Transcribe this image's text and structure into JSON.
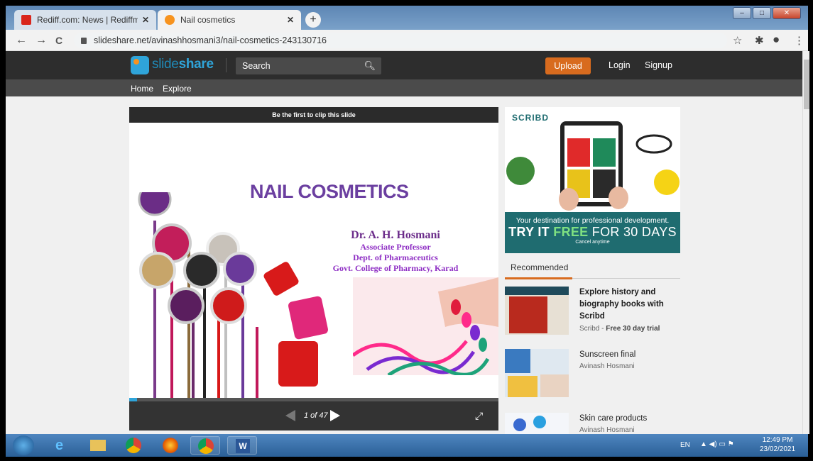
{
  "browser": {
    "tabs": [
      {
        "label": "Rediff.com: News | Rediffmail | St",
        "close": "✕"
      },
      {
        "label": "Nail cosmetics",
        "close": "✕"
      }
    ],
    "new_tab": "+",
    "url": "slideshare.net/avinashhosmani3/nail-cosmetics-243130716",
    "nav": {
      "back": "←",
      "forward": "→",
      "reload": "C"
    },
    "window_buttons": {
      "min": "–",
      "max": "□",
      "close": "✕"
    }
  },
  "slideshare": {
    "logo": "slideshare",
    "search_placeholder": "Search",
    "upload": "Upload",
    "login": "Login",
    "signup": "Signup",
    "nav": [
      "Home",
      "Explore"
    ]
  },
  "viewer": {
    "clip_text": "Be the first to clip this slide",
    "slide": {
      "title": "NAIL COSMETICS",
      "author": "Dr.  A. H. Hosmani",
      "lines": [
        "Associate Professor",
        "Dept. of Pharmaceutics",
        "Govt. College of Pharmacy, Karad"
      ]
    },
    "page_indicator": "1 of 47",
    "progress": 0.021
  },
  "ad": {
    "brand": "SCRIBD",
    "desc": "Your destination for professional development.",
    "cta_pre": "TRY IT ",
    "cta_free": "FREE",
    "cta_post": " FOR 30 DAYS",
    "cancel": "Cancel anytime"
  },
  "recommended": {
    "label": "Recommended",
    "items": [
      {
        "title": "Explore history and biography books with Scribd",
        "sub_a": "Scribd",
        "sub_b": "Free 30 day trial"
      },
      {
        "title": "Sunscreen final",
        "sub_a": "Avinash Hosmani"
      },
      {
        "title": "Skin care products",
        "sub_a": "Avinash Hosmani"
      }
    ]
  },
  "taskbar": {
    "lang": "EN",
    "time": "12:49 PM",
    "date": "23/02/2021"
  }
}
